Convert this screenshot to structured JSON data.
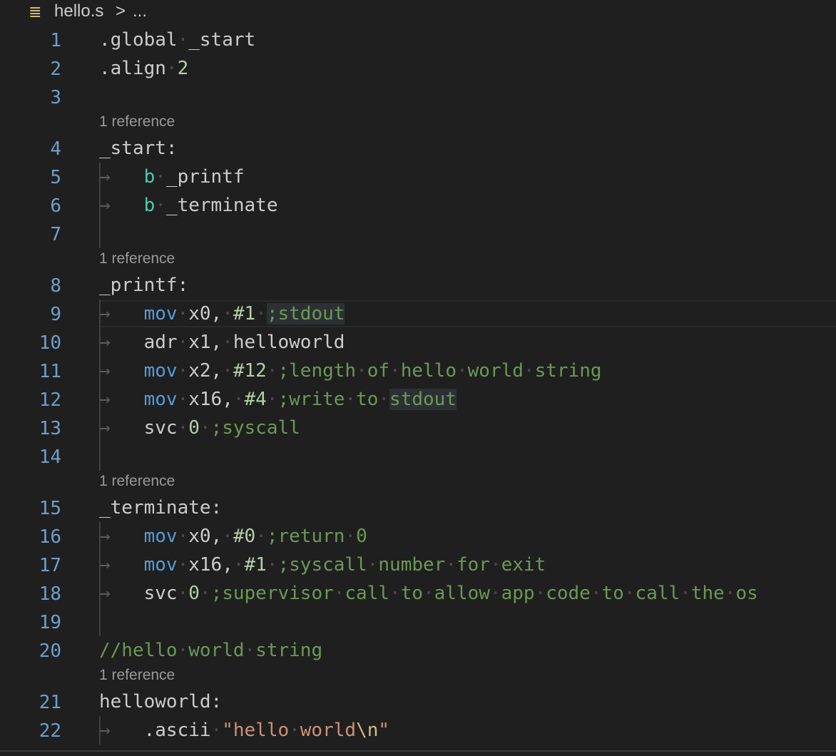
{
  "breadcrumb": {
    "file_icon": "≣",
    "file_name": "hello.s",
    "separator": ">",
    "ellipsis": "..."
  },
  "lens_text": "1 reference",
  "line_numbers": [
    "1",
    "2",
    "3",
    "4",
    "5",
    "6",
    "7",
    "8",
    "9",
    "10",
    "11",
    "12",
    "13",
    "14",
    "15",
    "16",
    "17",
    "18",
    "19",
    "20",
    "21",
    "22"
  ],
  "code": {
    "l1": [
      ".global",
      "_start"
    ],
    "l2": [
      ".align",
      "2"
    ],
    "l4": [
      "_start:"
    ],
    "l5": [
      "b",
      "_printf"
    ],
    "l6": [
      "b",
      "_terminate"
    ],
    "l8": [
      "_printf:"
    ],
    "l9": [
      "mov",
      "x0,",
      "#1",
      ";stdout"
    ],
    "l10": [
      "adr",
      "x1,",
      "helloworld"
    ],
    "l11": [
      "mov",
      "x2,",
      "#12",
      ";length",
      "of",
      "hello",
      "world",
      "string"
    ],
    "l12": [
      "mov",
      "x16,",
      "#4",
      ";write",
      "to",
      "stdout"
    ],
    "l13": [
      "svc",
      "0",
      ";syscall"
    ],
    "l15": [
      "_terminate:"
    ],
    "l16": [
      "mov",
      "x0,",
      "#0",
      ";return",
      "0"
    ],
    "l17": [
      "mov",
      "x16,",
      "#1",
      ";syscall",
      "number",
      "for",
      "exit"
    ],
    "l18": [
      "svc",
      "0",
      ";supervisor",
      "call",
      "to",
      "allow",
      "app",
      "code",
      "to",
      "call",
      "the",
      "os"
    ],
    "l20": [
      "//hello",
      "world",
      "string"
    ],
    "l21": [
      "helloworld:"
    ],
    "l22": [
      ".ascii",
      "\"hello",
      "world",
      "\\n",
      "\""
    ]
  },
  "colors": {
    "background": "#1f1f1f",
    "line_number": "#6e9fca",
    "keyword_branch": "#4ec9b0",
    "keyword_mov": "#569cd6",
    "number": "#b5cea8",
    "comment": "#6a9955",
    "string": "#ce9178",
    "escape": "#d7ba7d"
  }
}
